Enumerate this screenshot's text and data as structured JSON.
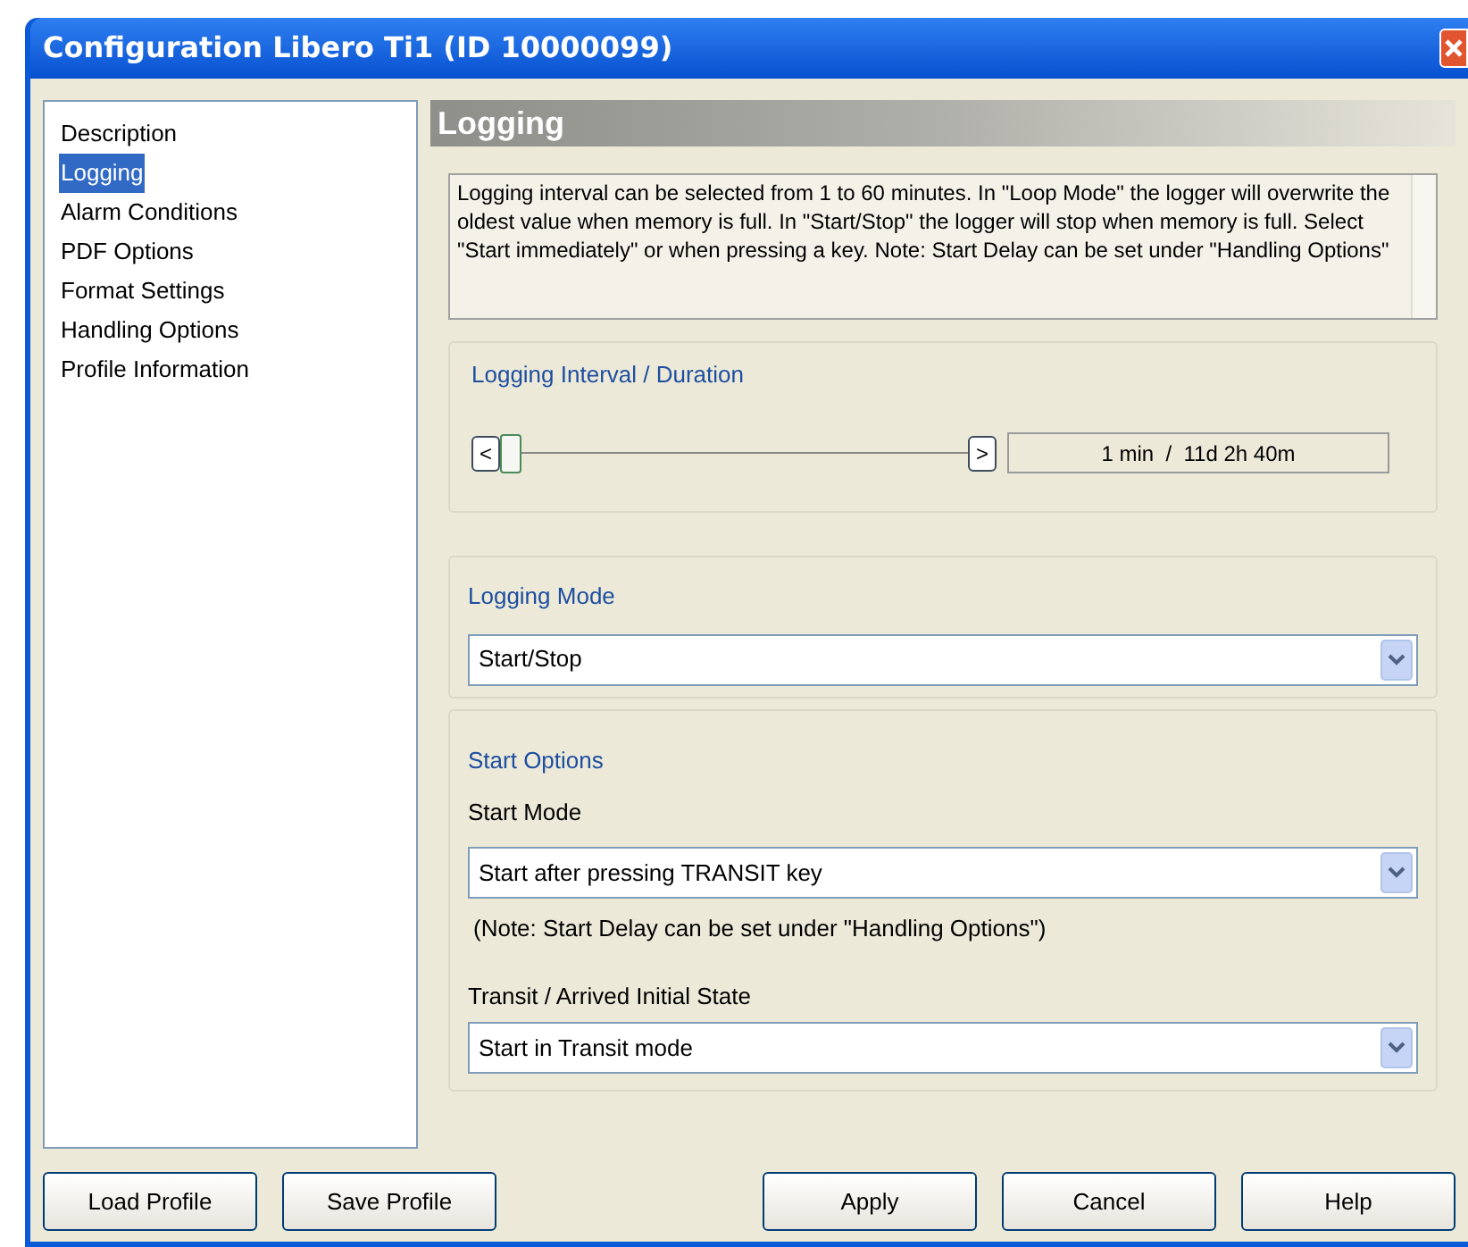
{
  "window": {
    "title": "Configuration Libero Ti1 (ID 10000099)"
  },
  "sidebar": {
    "items": [
      {
        "label": "Description",
        "selected": false
      },
      {
        "label": "Logging",
        "selected": true
      },
      {
        "label": "Alarm Conditions",
        "selected": false
      },
      {
        "label": "PDF Options",
        "selected": false
      },
      {
        "label": "Format Settings",
        "selected": false
      },
      {
        "label": "Handling Options",
        "selected": false
      },
      {
        "label": "Profile Information",
        "selected": false
      }
    ]
  },
  "page": {
    "heading": "Logging",
    "description": "Logging interval can be selected from 1 to 60 minutes. In \"Loop Mode\" the logger will overwrite the oldest value when memory is full. In \"Start/Stop\" the logger will stop when memory is full. Select \"Start immediately\" or when pressing a key. Note: Start Delay can be set under \"Handling Options\"",
    "interval": {
      "title": "Logging Interval / Duration",
      "decrease": "<",
      "increase": ">",
      "level": 0,
      "reading": "1 min  /  11d 2h 40m"
    },
    "logging_mode": {
      "title": "Logging Mode",
      "value": "Start/Stop"
    },
    "start_options": {
      "title": "Start Options",
      "start_mode_label": "Start Mode",
      "start_mode": "Start after pressing TRANSIT key",
      "note": "(Note: Start Delay can be set under \"Handling Options\")",
      "initial_state_label": "Transit / Arrived Initial State",
      "initial_state": "Start in Transit mode"
    }
  },
  "buttons": {
    "left": [
      "Load Profile",
      "Save Profile"
    ],
    "right": [
      "Apply",
      "Cancel",
      "Help"
    ]
  }
}
